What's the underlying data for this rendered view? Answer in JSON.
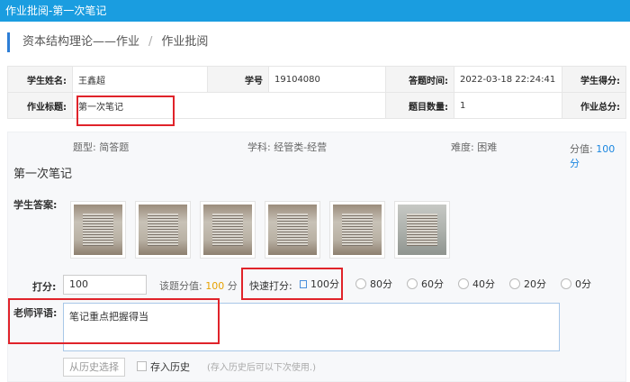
{
  "titlebar": {
    "title": "作业批阅-第一次笔记"
  },
  "breadcrumb": {
    "item1": "资本结构理论——作业",
    "sep": "/",
    "item2": "作业批阅"
  },
  "info": {
    "student_name_label": "学生姓名:",
    "student_name": "王鑫超",
    "student_id_label": "学号",
    "student_id": "19104080",
    "answer_time_label": "答题时间:",
    "answer_time": "2022-03-18 22:24:41",
    "student_score_label": "学生得分:",
    "hw_title_label": "作业标题:",
    "hw_title": "第一次笔记",
    "question_count_label": "题目数量:",
    "question_count": "1",
    "hw_total_label": "作业总分:"
  },
  "question": {
    "type": "题型: 简答题",
    "subject": "学科: 经管类-经营",
    "difficulty": "难度: 困难",
    "score_label": "分值:",
    "score_value": "100 分",
    "title": "第一次笔记",
    "answer_label": "学生答案:"
  },
  "grading": {
    "score_label": "打分:",
    "score_value": "100",
    "q_score_label": "该题分值:",
    "q_score_value": "100",
    "q_score_unit": "分",
    "quick_label": "快速打分:",
    "options": [
      "100分",
      "80分",
      "60分",
      "40分",
      "20分",
      "0分"
    ],
    "comment_label": "老师评语:",
    "comment_text": "笔记重点把握得当",
    "history_button": "从历史选择",
    "save_label": "存入历史",
    "save_hint": "(存入历史后可以下次使用.)"
  },
  "colors": {
    "titlebar": "#1a9de0",
    "accent": "#1a86e0",
    "highlight": "#e0232a",
    "orange": "#e7a100"
  }
}
